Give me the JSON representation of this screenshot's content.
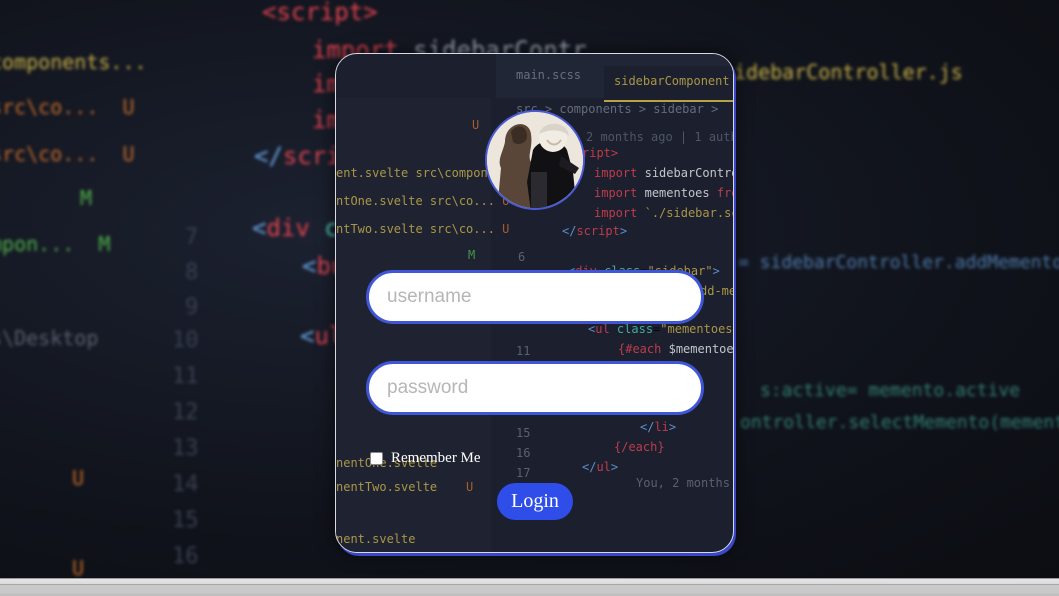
{
  "form": {
    "username_placeholder": "username",
    "password_placeholder": "password",
    "remember_label": "Remember Me",
    "login_label": "Login"
  },
  "colors": {
    "accent": "#2f4de8",
    "field_border": "#3f56d6",
    "card_border": "#d9dbe4"
  },
  "icons": {
    "avatar": "profile-avatar"
  }
}
